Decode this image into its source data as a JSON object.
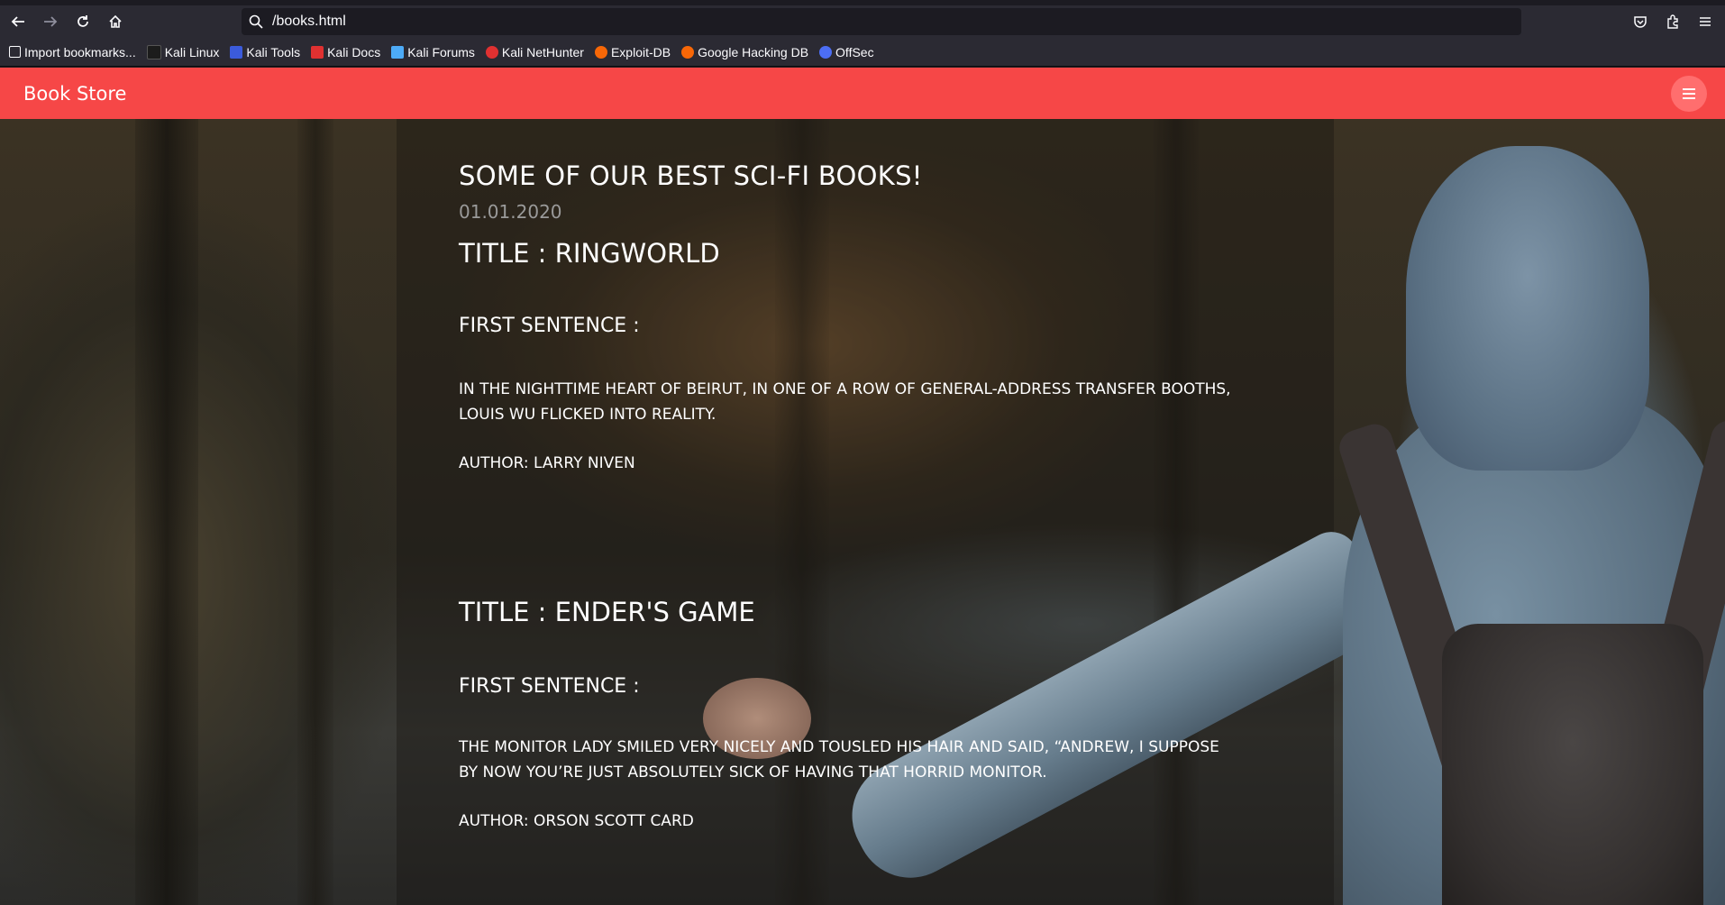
{
  "browser": {
    "url": "/books.html",
    "bookmarks": [
      {
        "label": "Import bookmarks...",
        "icon": "import-icon",
        "color": "#fbfbfe"
      },
      {
        "label": "Kali Linux",
        "icon": "kali-dragon-icon",
        "color": "#1c1c1c"
      },
      {
        "label": "Kali Tools",
        "icon": "kali-tools-icon",
        "color": "#3b5bdb"
      },
      {
        "label": "Kali Docs",
        "icon": "kali-docs-icon",
        "color": "#e03131"
      },
      {
        "label": "Kali Forums",
        "icon": "kali-forums-icon",
        "color": "#4dabf7"
      },
      {
        "label": "Kali NetHunter",
        "icon": "nethunter-icon",
        "color": "#e03131"
      },
      {
        "label": "Exploit-DB",
        "icon": "exploit-db-icon",
        "color": "#f76707"
      },
      {
        "label": "Google Hacking DB",
        "icon": "ghdb-icon",
        "color": "#f76707"
      },
      {
        "label": "OffSec",
        "icon": "offsec-icon",
        "color": "#4c6ef5"
      }
    ]
  },
  "site": {
    "brand": "Book Store",
    "accent_color": "#f64747"
  },
  "post": {
    "title": "SOME OF OUR BEST SCI-FI BOOKS!",
    "date": "01.01.2020"
  },
  "books": [
    {
      "title": "TITLE : RINGWORLD",
      "first_sentence_label": "FIRST SENTENCE :",
      "first_sentence": "IN THE NIGHTTIME HEART OF BEIRUT, IN ONE OF A ROW OF GENERAL-ADDRESS TRANSFER BOOTHS, LOUIS WU FLICKED INTO REALITY.",
      "author": "AUTHOR: LARRY NIVEN"
    },
    {
      "title": "TITLE : ENDER'S GAME",
      "first_sentence_label": "FIRST SENTENCE :",
      "first_sentence": "THE MONITOR LADY SMILED VERY NICELY AND TOUSLED HIS HAIR AND SAID, “ANDREW, I SUPPOSE BY NOW YOU’RE JUST ABSOLUTELY SICK OF HAVING THAT HORRID MONITOR.",
      "author": "AUTHOR: ORSON SCOTT CARD"
    }
  ]
}
